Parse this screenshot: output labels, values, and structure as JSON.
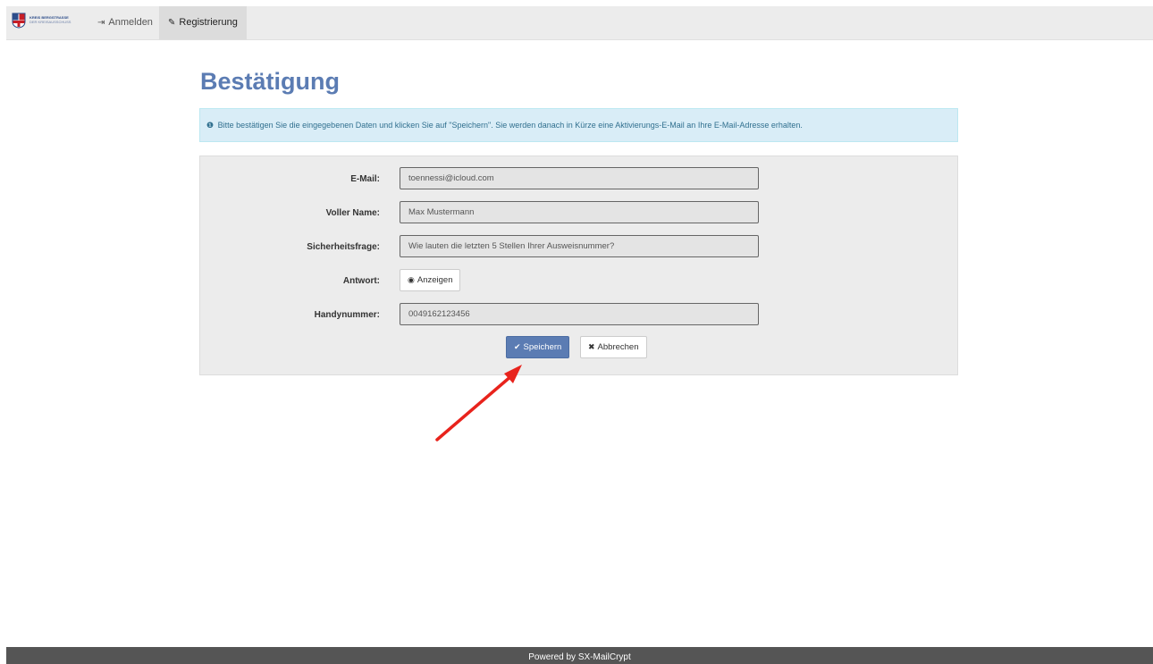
{
  "navbar": {
    "logo": {
      "title": "KREIS BERGSTRASSE",
      "subtitle": "DER KREISAUSSCHUSS",
      "icon": "coat-of-arms"
    },
    "items": [
      {
        "label": "Anmelden",
        "icon": "sign-in-icon",
        "active": false
      },
      {
        "label": "Registrierung",
        "icon": "edit-icon",
        "active": true
      }
    ]
  },
  "page": {
    "title": "Bestätigung"
  },
  "alert": {
    "icon": "info-circle-icon",
    "text": "Bitte bestätigen Sie die eingegebenen Daten und klicken Sie auf \"Speichern\". Sie werden danach in Kürze eine Aktivierungs-E-Mail an Ihre E-Mail-Adresse erhalten.",
    "color": "#d9edf7"
  },
  "form": {
    "email": {
      "label": "E-Mail:",
      "value": "toennessi@icloud.com"
    },
    "name": {
      "label": "Voller Name:",
      "value": "Max Mustermann"
    },
    "question": {
      "label": "Sicherheitsfrage:",
      "value": "Wie lauten die letzten 5 Stellen Ihrer Ausweisnummer?"
    },
    "answer": {
      "label": "Antwort:",
      "button_label": "Anzeigen",
      "icon": "eye-icon"
    },
    "phone": {
      "label": "Handynummer:",
      "value": "0049162123456"
    },
    "save_button": {
      "label": "Speichern",
      "icon": "check-icon"
    },
    "cancel_button": {
      "label": "Abbrechen",
      "icon": "times-icon"
    }
  },
  "annotation": {
    "type": "arrow",
    "color": "#e8231c",
    "target": "save-button"
  },
  "footer": {
    "text": "Powered by SX-MailCrypt"
  },
  "colors": {
    "accent": "#5b7cb3",
    "navbar_bg": "#ececec",
    "footer_bg": "#555555"
  }
}
